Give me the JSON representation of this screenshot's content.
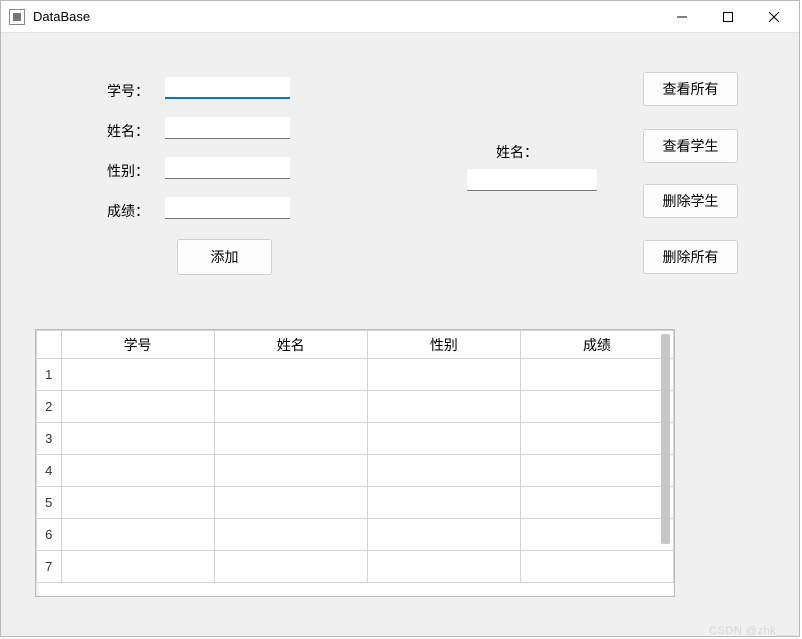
{
  "window": {
    "title": "DataBase"
  },
  "form": {
    "id_label": "学号：",
    "name_label": "姓名：",
    "gender_label": "性别：",
    "score_label": "成绩：",
    "id_value": "",
    "name_value": "",
    "gender_value": "",
    "score_value": "",
    "add_button": "添加"
  },
  "search": {
    "name_label": "姓名：",
    "name_value": ""
  },
  "buttons": {
    "view_all": "查看所有",
    "view_student": "查看学生",
    "delete_student": "删除学生",
    "delete_all": "删除所有"
  },
  "table": {
    "headers": [
      "学号",
      "姓名",
      "性别",
      "成绩"
    ],
    "rows": [
      {
        "num": "1",
        "cells": [
          "",
          "",
          "",
          ""
        ]
      },
      {
        "num": "2",
        "cells": [
          "",
          "",
          "",
          ""
        ]
      },
      {
        "num": "3",
        "cells": [
          "",
          "",
          "",
          ""
        ]
      },
      {
        "num": "4",
        "cells": [
          "",
          "",
          "",
          ""
        ]
      },
      {
        "num": "5",
        "cells": [
          "",
          "",
          "",
          ""
        ]
      },
      {
        "num": "6",
        "cells": [
          "",
          "",
          "",
          ""
        ]
      },
      {
        "num": "7",
        "cells": [
          "",
          "",
          "",
          ""
        ]
      }
    ]
  },
  "watermark": "CSDN @zhk___"
}
